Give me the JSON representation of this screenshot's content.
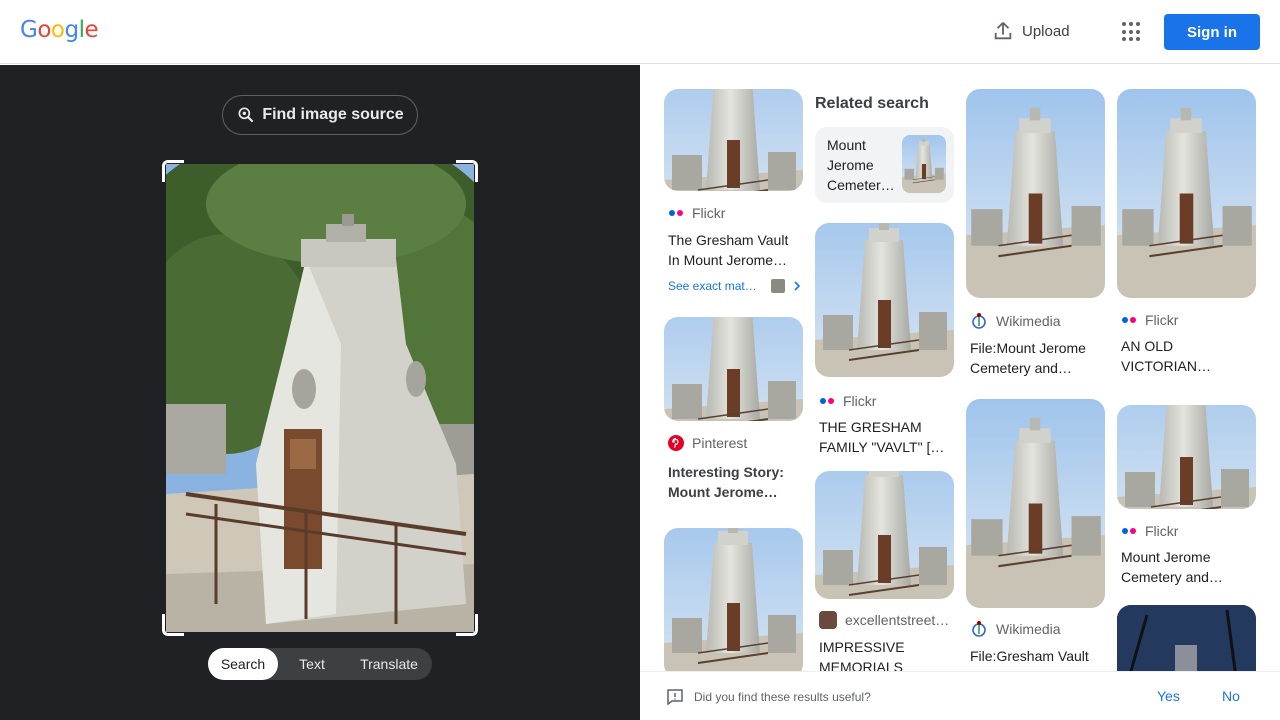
{
  "header": {
    "logo_text": "Google",
    "upload_label": "Upload",
    "signin_label": "Sign in"
  },
  "left_panel": {
    "find_source_label": "Find image source",
    "tabs": [
      {
        "label": "Search",
        "active": true
      },
      {
        "label": "Text",
        "active": false
      },
      {
        "label": "Translate",
        "active": false
      }
    ]
  },
  "results": {
    "col1": [
      {
        "source": "Flickr",
        "source_icon": "flickr-icon",
        "title": "The Gresham Vault In Mount Jerome…",
        "exact_match_label": "See exact mat…"
      },
      {
        "source": "Pinterest",
        "source_icon": "pinterest-icon",
        "title": "Interesting Story: Mount Jerome…"
      }
    ],
    "related": {
      "heading": "Related search",
      "item_label": "Mount Jerome Cemeter…"
    },
    "col2": [
      {
        "source": "Flickr",
        "source_icon": "flickr-icon",
        "title": "THE GRESHAM FAMILY \"VAVLT\" […"
      },
      {
        "source": "excellentstreet…",
        "source_icon": "site-icon",
        "title": "IMPRESSIVE MEMORIALS AND…"
      }
    ],
    "col3": [
      {
        "source": "Wikimedia",
        "source_icon": "wikimedia-icon",
        "title": "File:Mount Jerome Cemetery and…"
      },
      {
        "source": "Wikimedia",
        "source_icon": "wikimedia-icon",
        "title": "File:Gresham Vault at Mount Jerome…"
      }
    ],
    "col4": [
      {
        "source": "Flickr",
        "source_icon": "flickr-icon",
        "title": "AN OLD VICTORIAN…"
      },
      {
        "source": "Flickr",
        "source_icon": "flickr-icon",
        "title": "Mount Jerome Cemetery and…"
      }
    ]
  },
  "feedback": {
    "question": "Did you find these results useful?",
    "yes_label": "Yes",
    "no_label": "No"
  },
  "colors": {
    "accent": "#1a73e8",
    "dark_panel": "#202124",
    "flickr_blue": "#0063dc",
    "flickr_pink": "#ff0084",
    "pinterest_red": "#e60023"
  }
}
